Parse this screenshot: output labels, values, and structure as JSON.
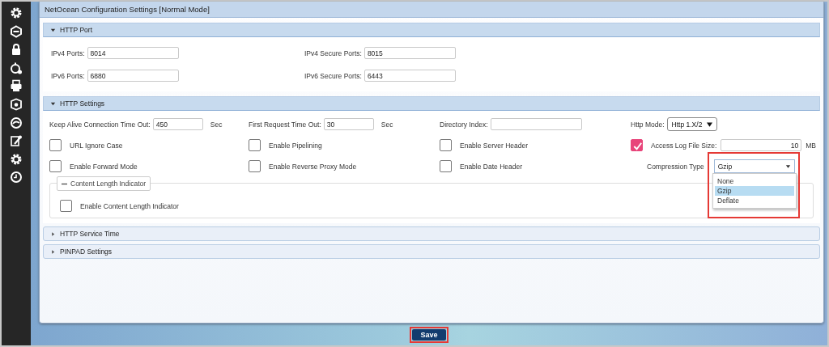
{
  "window": {
    "title": "NetOcean Configuration Settings [Normal Mode]"
  },
  "http_port": {
    "title": "HTTP Port",
    "expanded": true,
    "fields": [
      {
        "label": "IPv4 Ports:",
        "value": "8014"
      },
      {
        "label": "IPv4 Secure Ports:",
        "value": "8015"
      },
      {
        "label": "IPv6 Ports:",
        "value": "6880"
      },
      {
        "label": "IPv6 Secure Ports:",
        "value": "6443"
      }
    ]
  },
  "http_settings": {
    "title": "HTTP Settings",
    "expanded": true,
    "fields": [
      {
        "label": "Keep Alive Connection Time Out:",
        "value": "450",
        "unit": "Sec"
      },
      {
        "label": "First Request Time Out:",
        "value": "30",
        "unit": "Sec"
      },
      {
        "label": "Directory Index:"
      }
    ],
    "http_mode": {
      "label": "Http Mode:",
      "value": "Http 1.X/2"
    },
    "checkboxes": [
      {
        "label": "URL Ignore Case",
        "checked": false
      },
      {
        "label": "Enable Pipelining",
        "checked": false
      },
      {
        "label": "Enable Server Header",
        "checked": false
      },
      {
        "label": "Enable Forward Mode",
        "checked": false
      },
      {
        "label": "Enable Reverse Proxy Mode",
        "checked": false
      },
      {
        "label": "Enable Date Header",
        "checked": false
      }
    ],
    "access_log": {
      "label": "Access Log File Size:",
      "checked": true,
      "value": "10",
      "unit": "MB"
    },
    "compression": {
      "label": "Compression Type",
      "value": "Gzip",
      "options": [
        {
          "label": "None",
          "selected": false
        },
        {
          "label": "Gzip",
          "selected": true
        },
        {
          "label": "Deflate",
          "selected": false
        }
      ]
    },
    "content_length": {
      "title": "Content Length Indicator",
      "expanded": true,
      "checkbox": {
        "label": "Enable Content Length Indicator",
        "checked": false
      }
    }
  },
  "collapsed_sections": [
    {
      "title": "HTTP Service Time",
      "expanded": false
    },
    {
      "title": "PINPAD Settings",
      "expanded": false
    }
  ],
  "save_button": {
    "label": "Save"
  }
}
